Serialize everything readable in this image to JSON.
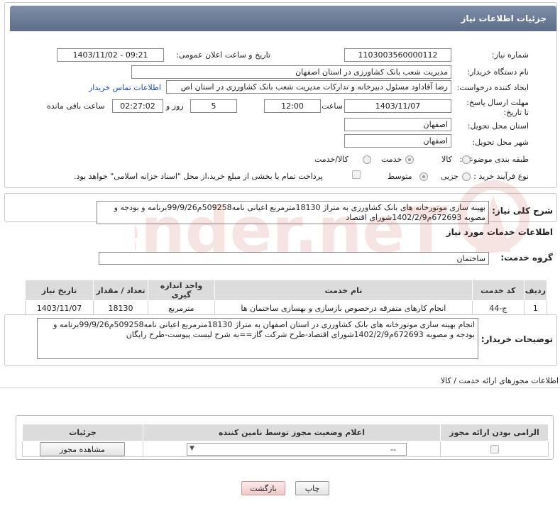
{
  "header": {
    "title": "جزئیات اطلاعات نیاز"
  },
  "form": {
    "need_number_label": "شماره نیاز:",
    "need_number": "1103003560000112",
    "announce_label": "تاریخ و ساعت اعلان عمومی:",
    "announce_value": "1403/11/02 - 09:21",
    "buyer_org_label": "نام دستگاه خریدار:",
    "buyer_org": "مدیریت شعب بانک کشاورزی در استان اصفهان",
    "requester_label": "ایجاد کننده درخواست:",
    "requester": "رضا آقاداود مسئول دبیرخانه و تدارکات مدیریت شعب بانک کشاورزی در استان اص",
    "contact_link": "اطلاعات تماس خریدار",
    "deadline_label": "مهلت ارسال پاسخ: تا تاریخ:",
    "deadline_date": "1403/11/07",
    "time_label": "ساعت",
    "deadline_time": "12:00",
    "days_value": "5",
    "days_label": "روز و",
    "remaining_time": "02:27:02",
    "remaining_label": "ساعت باقی مانده",
    "province_label": "استان محل تحویل:",
    "province": "اصفهان",
    "city_label": "شهر محل تحویل:",
    "city": "اصفهان",
    "category_label": "طبقه بندی موضوعی:",
    "category_options": [
      "کالا",
      "خدمت",
      "کالا/خدمت"
    ],
    "process_label": "نوع فرآیند خرید :",
    "process_options": [
      "جزیی",
      "متوسط"
    ],
    "payment_note": "پرداخت تمام یا بخشی از مبلغ خرید،از محل \"اسناد خزانه اسلامی\" خواهد بود."
  },
  "summary": {
    "label": "شرح کلی نیاز:",
    "text": "بهینه سازی موتورخانه های بانک کشاورزی به متراژ 18130مترمربع اعیانی نامه509258م99/9/26برنامه و بودجه و مصوبه 672693م1402/2/9شورای اقتصاد"
  },
  "services": {
    "title": "اطلاعات خدمات مورد نیاز",
    "group_label": "گروه خدمت:",
    "group_value": "ساختمان",
    "columns": [
      "ردیف",
      "کد خدمت",
      "نام خدمت",
      "واحد اندازه گیری",
      "تعداد / مقدار",
      "تاریخ نیاز"
    ],
    "rows": [
      [
        "1",
        "ج-44",
        "انجام کارهای متفرقه درخصوص بازسازی و بهسازی ساختمان ها",
        "مترمربع",
        "18130",
        "1403/11/07"
      ]
    ]
  },
  "buyer_notes": {
    "label": "توضیحات خریدار:",
    "text": "انجام بهینه سازی موتورخانه های بانک کشاورزی در استان اصفهان به متراژ 18130مترمربع اعیانی نامه509258م99/9/26برنامه و بودجه و مصوبه 672693م1402/2/9شورای اقتصاد-طرح شرکت گاز==به شرح لیست پیوست-طرح رایگان"
  },
  "permits": {
    "title": "اطلاعات مجوزهای ارائه خدمت / کالا",
    "columns": [
      "الزامی بودن ارائه مجوز",
      "اعلام وضعیت مجوز توسط نامین کننده",
      "جزئیات"
    ],
    "select_value": "--",
    "view_button": "مشاهده مجوز"
  },
  "footer": {
    "print_button": "چاپ",
    "back_button": "بازگشت"
  },
  "watermark": {
    "text": "AriaTender.neT"
  },
  "colors": {
    "header": "#6b7a96",
    "link": "#1b45c4",
    "watermark": "#c0392b"
  }
}
